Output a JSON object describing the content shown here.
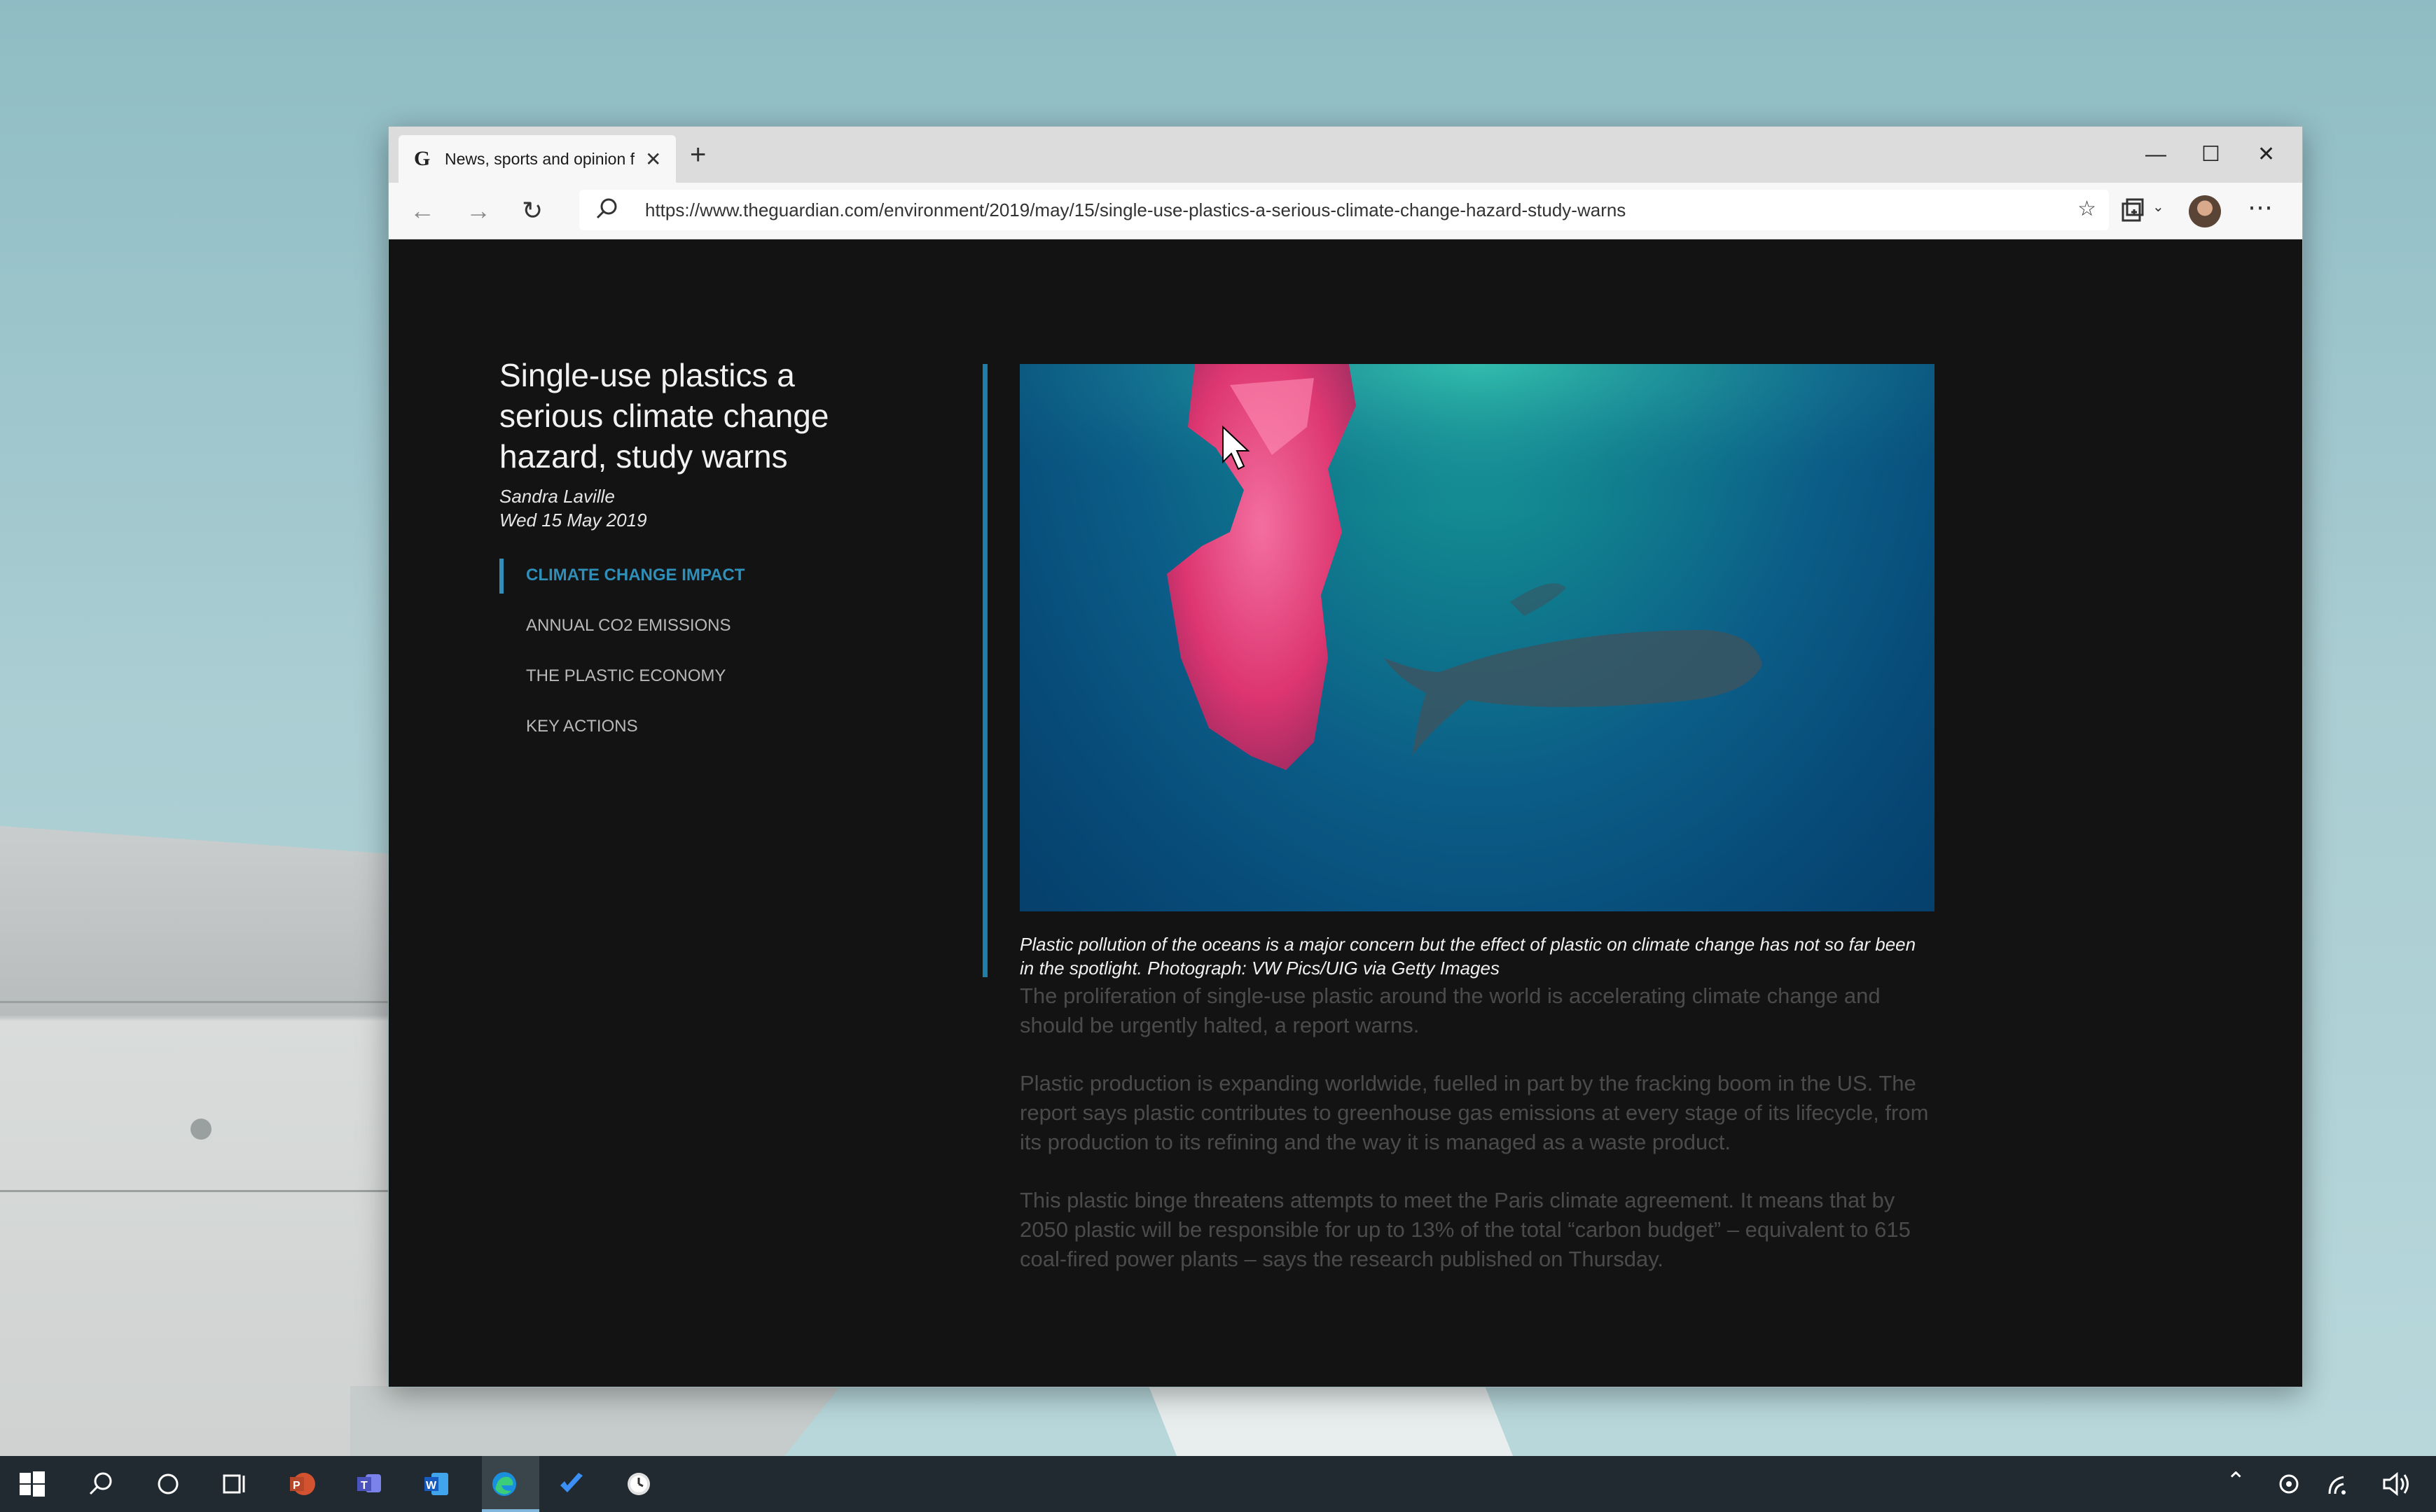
{
  "browser": {
    "tab_title": "News, sports and opinion f",
    "tab_favicon": "G",
    "url": "https://www.theguardian.com/environment/2019/may/15/single-use-plastics-a-serious-climate-change-hazard-study-warns"
  },
  "article": {
    "title": "Single-use plastics a serious climate change hazard, study warns",
    "author": "Sandra Laville",
    "date": "Wed 15 May 2019",
    "toc": [
      {
        "label": "CLIMATE CHANGE IMPACT",
        "active": true
      },
      {
        "label": "ANNUAL CO2 EMISSIONS",
        "active": false
      },
      {
        "label": "THE PLASTIC ECONOMY",
        "active": false
      },
      {
        "label": "KEY ACTIONS",
        "active": false
      }
    ],
    "caption": "Plastic pollution of the oceans is a major concern but the effect of plastic on climate change has not so far been in the spotlight. Photograph: VW Pics/UIG via Getty Images",
    "paragraphs": [
      "The proliferation of single-use plastic around the world is accelerating climate change and should be urgently halted, a report warns.",
      "Plastic production is expanding worldwide, fuelled in part by the fracking boom in the US. The report says plastic contributes to greenhouse gas emissions at every stage of its lifecycle, from its production to its refining and the way it is managed as a waste product.",
      "This plastic binge threatens attempts to meet the Paris climate agreement. It means that by 2050 plastic will be responsible for up to 13% of the total “carbon budget” – equivalent to 615 coal-fired power plants – says the research published on Thursday."
    ]
  },
  "colors": {
    "accent": "#2f8fb8",
    "page_bg": "#131313",
    "taskbar_bg": "#202a30"
  },
  "icons": {
    "tab_close": "close-icon",
    "new_tab": "plus-icon",
    "back": "back-arrow-icon",
    "forward": "forward-arrow-icon",
    "refresh": "refresh-icon",
    "search": "search-icon",
    "favorites": "favorites-star-icon",
    "collections": "collections-icon",
    "profile": "avatar",
    "menu": "more-icon"
  }
}
